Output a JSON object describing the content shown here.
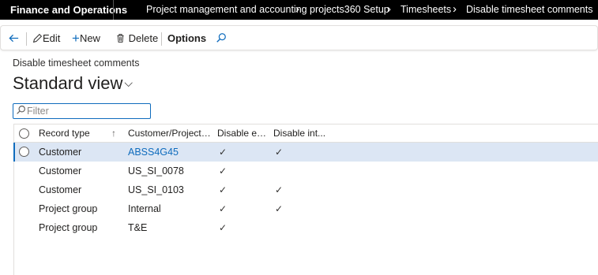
{
  "app": {
    "name": "Finance and Operations"
  },
  "breadcrumb": [
    "Project management and accounting",
    "projects360 Setup",
    "Timesheets",
    "Disable timesheet comments"
  ],
  "actions": {
    "edit": "Edit",
    "new": "New",
    "delete": "Delete",
    "options": "Options"
  },
  "page": {
    "caption": "Disable timesheet comments",
    "view": "Standard view"
  },
  "filter": {
    "placeholder": "Filter"
  },
  "grid": {
    "columns": [
      "Record type",
      "Customer/Project g...",
      "Disable ext...",
      "Disable int..."
    ],
    "rows": [
      {
        "record_type": "Customer",
        "group": "ABSS4G45",
        "disable_ext": "✓",
        "disable_int": "✓",
        "selected": true
      },
      {
        "record_type": "Customer",
        "group": "US_SI_0078",
        "disable_ext": "✓",
        "disable_int": ""
      },
      {
        "record_type": "Customer",
        "group": "US_SI_0103",
        "disable_ext": "✓",
        "disable_int": "✓"
      },
      {
        "record_type": "Project group",
        "group": "Internal",
        "disable_ext": "✓",
        "disable_int": "✓"
      },
      {
        "record_type": "Project group",
        "group": "T&E",
        "disable_ext": "✓",
        "disable_int": ""
      }
    ]
  },
  "colors": {
    "brand_bar": "#000000",
    "accent": "#0f6cbd",
    "selected_row": "#dce6f4"
  }
}
